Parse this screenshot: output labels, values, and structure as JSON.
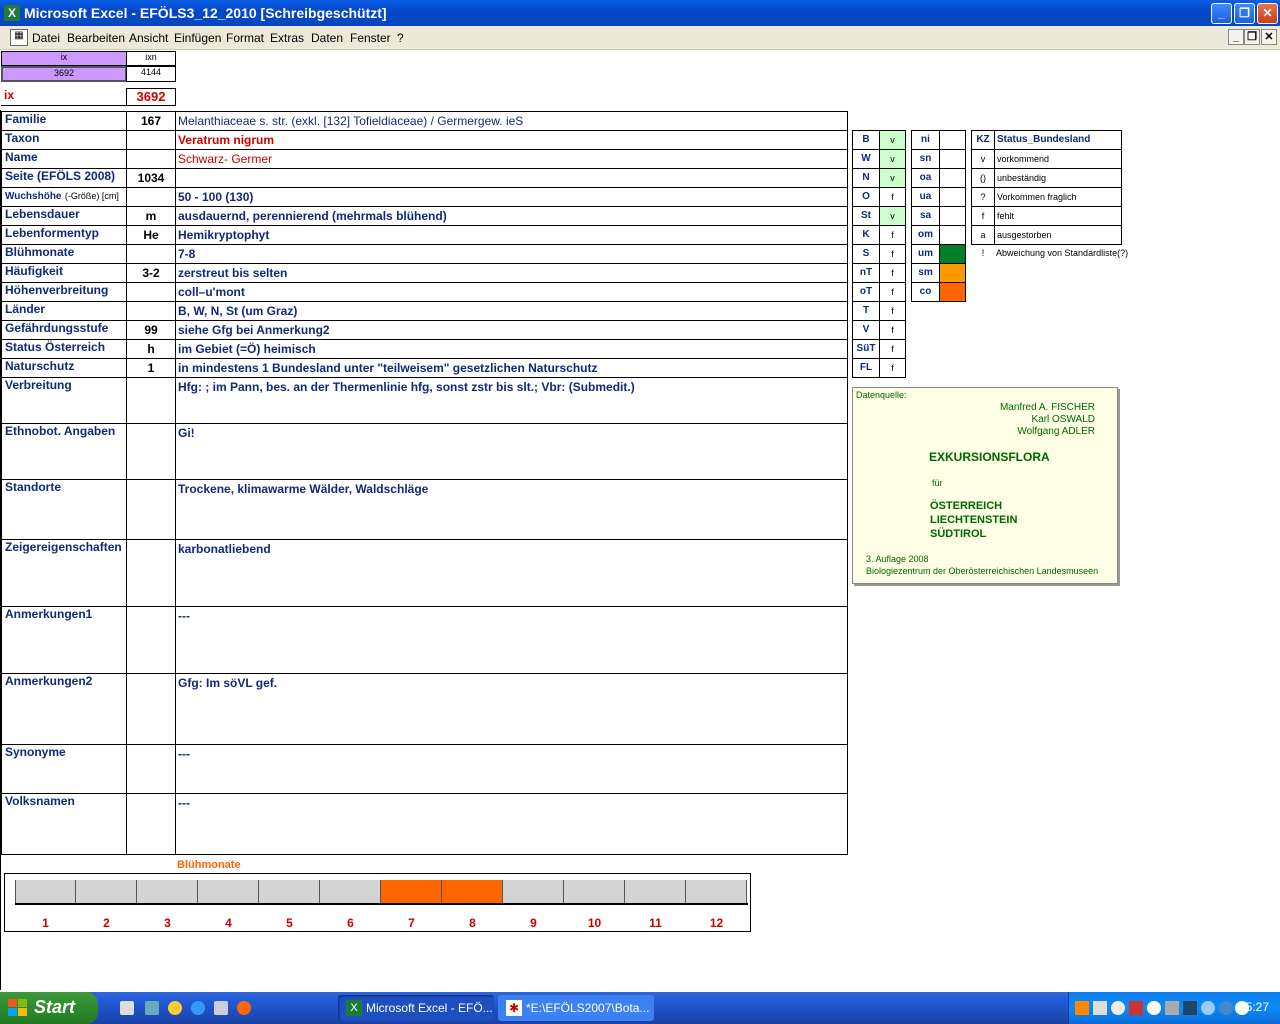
{
  "window": {
    "title": "Microsoft Excel - EFÖLS3_12_2010  [Schreibgeschützt]",
    "minimize": "_",
    "restore": "❐",
    "close": "✕"
  },
  "menu": {
    "items": [
      "Datei",
      "Bearbeiten",
      "Ansicht",
      "Einfügen",
      "Format",
      "Extras",
      "Daten",
      "Fenster",
      "?"
    ],
    "mdi_min": "_",
    "mdi_restore": "❐",
    "mdi_close": "✕"
  },
  "top_cells": {
    "ix_header": "ix",
    "ixn_header": "ixn",
    "ix_value": "3692",
    "ixn_value": "4144",
    "ix_label": "ix",
    "ix_big_value": "3692"
  },
  "fields": [
    {
      "label": "Familie",
      "code": "167",
      "text": "Melanthiaceae s. str. (exkl. [132] Tofieldiaceae)  /  Germergew. ieS"
    },
    {
      "label": "Taxon",
      "code": "",
      "text": "Veratrum nigrum"
    },
    {
      "label": "Name",
      "code": "",
      "text": "Schwarz- Germer"
    },
    {
      "label": "Seite (EFÖLS 2008)",
      "code": "1034",
      "text": ""
    },
    {
      "label": "Wuchshöhe",
      "label_suffix": "(-Größe) [cm]",
      "code": "",
      "text": " 50 - 100 (130)"
    },
    {
      "label": "Lebensdauer",
      "code": "m",
      "text": "ausdauernd, perennierend (mehrmals blühend)"
    },
    {
      "label": "Lebenformentyp",
      "code": "He",
      "text": "Hemikryptophyt"
    },
    {
      "label": "Blühmonate",
      "code": "",
      "text": " 7-8"
    },
    {
      "label": "Häufigkeit",
      "code": "3-2",
      "text": "zerstreut bis selten"
    },
    {
      "label": "Höhenverbreitung",
      "code": "",
      "text": "coll–u'mont"
    },
    {
      "label": "Länder",
      "code": "",
      "text": "B, W, N, St (um Graz)"
    },
    {
      "label": "Gefährdungsstufe",
      "code": "99",
      "text": "siehe Gfg bei Anmerkung2"
    },
    {
      "label": "Status Österreich",
      "code": "h",
      "text": "im Gebiet (=Ö) heimisch"
    },
    {
      "label": "Naturschutz",
      "code": "1",
      "text": "in mindestens 1 Bundesland unter \"teilweisem\" gesetzlichen Naturschutz"
    },
    {
      "label": "Verbreitung",
      "code": "",
      "text": "Hfg: ; im Pann, bes. an der Thermenlinie hfg, sonst zstr bis slt.;  Vbr: (Submedit.)"
    },
    {
      "label": "Ethnobot. Angaben",
      "code": "",
      "text": "Gi!"
    },
    {
      "label": "Standorte",
      "code": "",
      "text": "Trockene, klimawarme Wälder, Waldschläge"
    },
    {
      "label": "Zeigereigenschaften",
      "code": "",
      "text": " karbonatliebend"
    },
    {
      "label": "Anmerkungen1",
      "code": "",
      "text": "---"
    },
    {
      "label": "Anmerkungen2",
      "code": "",
      "text": "Gfg: Im söVL gef."
    },
    {
      "label": "Synonyme",
      "code": "",
      "text": "---"
    },
    {
      "label": "Volksnamen",
      "code": "",
      "text": "---"
    }
  ],
  "states": [
    {
      "k": "B",
      "v": "v",
      "on": true
    },
    {
      "k": "W",
      "v": "v",
      "on": true
    },
    {
      "k": "N",
      "v": "v",
      "on": true
    },
    {
      "k": "O",
      "v": "f",
      "on": false
    },
    {
      "k": "St",
      "v": "v",
      "on": true
    },
    {
      "k": "K",
      "v": "f",
      "on": false
    },
    {
      "k": "S",
      "v": "f",
      "on": false
    },
    {
      "k": "nT",
      "v": "f",
      "on": false
    },
    {
      "k": "oT",
      "v": "f",
      "on": false
    },
    {
      "k": "T",
      "v": "f",
      "on": false
    },
    {
      "k": "V",
      "v": "f",
      "on": false
    },
    {
      "k": "SüT",
      "v": "f",
      "on": false
    },
    {
      "k": "FL",
      "v": "f",
      "on": false
    }
  ],
  "altitude": [
    {
      "k": "ni",
      "color": ""
    },
    {
      "k": "sn",
      "color": ""
    },
    {
      "k": "oa",
      "color": ""
    },
    {
      "k": "ua",
      "color": ""
    },
    {
      "k": "sa",
      "color": ""
    },
    {
      "k": "om",
      "color": ""
    },
    {
      "k": "um",
      "color": "#00802b"
    },
    {
      "k": "sm",
      "color": "#ff9900"
    },
    {
      "k": "co",
      "color": "#ff6600"
    }
  ],
  "legend": {
    "kz_header": "KZ",
    "status_header": "Status_Bundesland",
    "rows": [
      {
        "kz": "v",
        "text": "vorkommend"
      },
      {
        "kz": "()",
        "text": "unbeständig"
      },
      {
        "kz": "?",
        "text": "Vorkommen fraglich"
      },
      {
        "kz": "f",
        "text": "fehlt"
      },
      {
        "kz": "a",
        "text": "ausgestorben"
      },
      {
        "kz": "!",
        "text": "Abweichung von Standardliste(?)"
      }
    ]
  },
  "source_box": {
    "label": "Datenquelle:",
    "authors": [
      "Manfred A. FISCHER",
      "Karl OSWALD",
      "Wolfgang ADLER"
    ],
    "title": "EXKURSIONSFLORA",
    "fuer": "für",
    "countries": [
      "ÖSTERREICH",
      "LIECHTENSTEIN",
      "SÜDTIROL"
    ],
    "edition": "3. Auflage 2008",
    "publisher": "Biologiezentrum der Oberösterreichischen Landesmuseen"
  },
  "bloom": {
    "title": "Blühmonate",
    "months": [
      "1",
      "2",
      "3",
      "4",
      "5",
      "6",
      "7",
      "8",
      "9",
      "10",
      "11",
      "12"
    ],
    "active": [
      7,
      8
    ],
    "active_color": "#ff6600",
    "inactive_color": "#d4d4d4"
  },
  "taskbar": {
    "start": "Start",
    "btn_excel": "Microsoft Excel - EFÖ...",
    "btn_doc": "*E:\\EFÖLS2007\\Bota...",
    "clock": "05:27"
  }
}
